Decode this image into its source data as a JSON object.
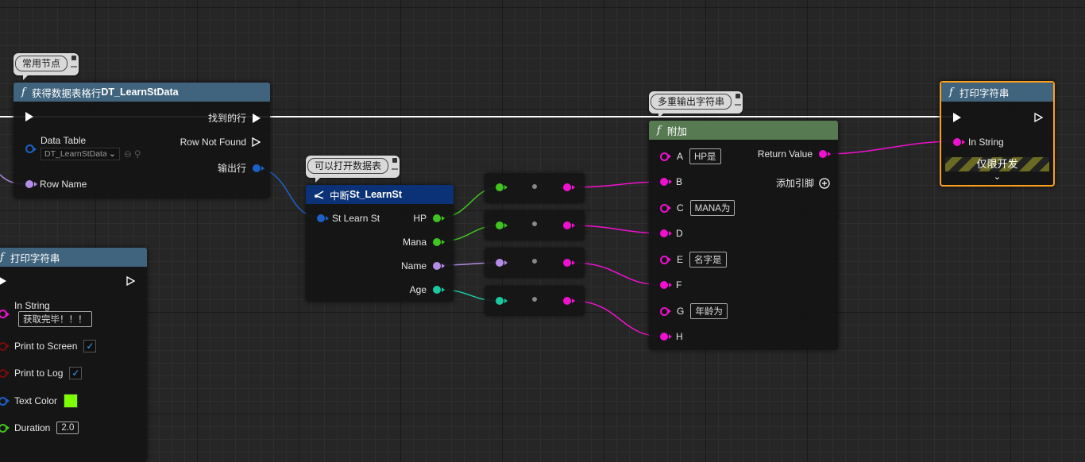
{
  "colors": {
    "pin_blue": "#1c60c7",
    "pin_purple": "#b48ce6",
    "pin_green": "#40c420",
    "pin_teal": "#1bc9a0",
    "pin_magenta": "#f010d0",
    "pin_darkred": "#7a0b0b",
    "header_func": "#41647e",
    "header_break": "#0b3276",
    "header_append": "#577a52",
    "selected": "#ff9f1a"
  },
  "bubbles": {
    "common_nodes": "常用节点",
    "can_open_table": "可以打开数据表",
    "multi_output": "多重输出字符串"
  },
  "get_row_node": {
    "title": "获得数据表格行",
    "title_bold": "DT_LearnStData",
    "row_found": "找到的行",
    "row_not_found": "Row Not Found",
    "data_table": "Data Table",
    "data_table_value": "DT_LearnStData",
    "out_row": "输出行",
    "row_name": "Row Name"
  },
  "break_node": {
    "title": "中断",
    "title_bold": "St_LearnSt",
    "input": "St Learn St",
    "outputs": [
      "HP",
      "Mana",
      "Name",
      "Age"
    ]
  },
  "append_node": {
    "title": "附加",
    "pins": [
      {
        "label": "A",
        "value": "HP是"
      },
      {
        "label": "B",
        "value": ""
      },
      {
        "label": "C",
        "value": "MANA为"
      },
      {
        "label": "D",
        "value": ""
      },
      {
        "label": "E",
        "value": "名字是"
      },
      {
        "label": "F",
        "value": ""
      },
      {
        "label": "G",
        "value": "年龄为"
      },
      {
        "label": "H",
        "value": ""
      }
    ],
    "return_value": "Return Value",
    "add_pin": "添加引脚"
  },
  "print_node_right": {
    "title": "打印字符串",
    "in_string": "In String",
    "dev_only": "仅限开发"
  },
  "print_node_left": {
    "title": "打印字符串",
    "in_string": "In String",
    "in_string_value": "获取完毕！！！",
    "print_to_screen": "Print to Screen",
    "print_to_log": "Print to Log",
    "text_color": "Text Color",
    "text_color_value": "#7cff00",
    "duration": "Duration",
    "duration_value": "2.0"
  }
}
